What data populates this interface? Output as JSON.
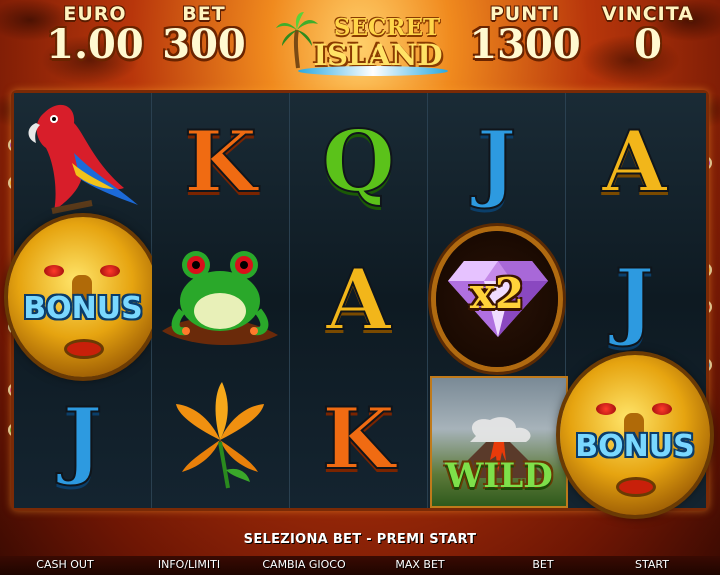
{
  "header": {
    "euro": {
      "label": "EURO",
      "value": "1.00"
    },
    "bet": {
      "label": "BET",
      "value": "300"
    },
    "punti": {
      "label": "PUNTI",
      "value": "1300"
    },
    "vincita": {
      "label": "VINCITA",
      "value": "0"
    },
    "logo": {
      "line1": "SECRET",
      "line2": "ISLAND"
    }
  },
  "reels": [
    [
      "parrot",
      "bonus",
      "J"
    ],
    [
      "K",
      "frog",
      "lily"
    ],
    [
      "Q",
      "A",
      "K"
    ],
    [
      "J",
      "x2-diamond",
      "wild"
    ],
    [
      "A",
      "J",
      "bonus"
    ]
  ],
  "symbols": {
    "r2_top": "K",
    "r3_top": "Q",
    "r3_mid": "A",
    "r3_bot": "K",
    "r4_top": "J",
    "r5_top": "A",
    "r5_mid": "J",
    "r1_bot": "J",
    "bonus": "BONUS",
    "multiplier": "x2",
    "wild": "WILD"
  },
  "status_message": "SELEZIONA BET - PREMI START",
  "buttons": {
    "cash_out": "CASH OUT",
    "info": "INFO/LIMITI",
    "change_game": "CAMBIA GIOCO",
    "max_bet": "MAX BET",
    "bet": "BET",
    "start": "START"
  },
  "colors": {
    "letter_k": "#f06b12",
    "letter_q": "#5bc21a",
    "letter_j": "#2d9ae0",
    "letter_a": "#f2b61a",
    "bonus_text": "#7ad8ff",
    "wild_text": "#7ee04a",
    "multiplier_text": "#ffd23a"
  },
  "icons": [
    "parrot-icon",
    "frog-icon",
    "lily-icon",
    "diamond-icon",
    "volcano-icon",
    "bonus-mask-icon",
    "palm-tree-icon"
  ]
}
